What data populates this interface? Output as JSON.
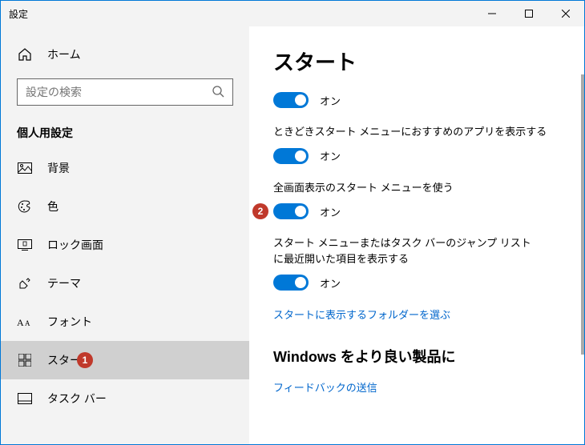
{
  "titlebar": {
    "title": "設定"
  },
  "home": {
    "label": "ホーム"
  },
  "search": {
    "placeholder": "設定の検索"
  },
  "section": {
    "title": "個人用設定"
  },
  "sidebar": {
    "items": [
      {
        "label": "背景"
      },
      {
        "label": "色"
      },
      {
        "label": "ロック画面"
      },
      {
        "label": "テーマ"
      },
      {
        "label": "フォント"
      },
      {
        "label": "スタート"
      },
      {
        "label": "タスク バー"
      }
    ]
  },
  "content": {
    "title": "スタート",
    "toggles": [
      {
        "label": "",
        "state": "オン"
      },
      {
        "label": "ときどきスタート メニューにおすすめのアプリを表示する",
        "state": "オン"
      },
      {
        "label": "全画面表示のスタート メニューを使う",
        "state": "オン"
      },
      {
        "label": "スタート メニューまたはタスク バーのジャンプ リストに最近開いた項目を表示する",
        "state": "オン"
      }
    ],
    "link": "スタートに表示するフォルダーを選ぶ",
    "subheading": "Windows をより良い製品に",
    "feedback_link": "フィードバックの送信"
  },
  "annotations": {
    "badge1": "1",
    "badge2": "2"
  }
}
